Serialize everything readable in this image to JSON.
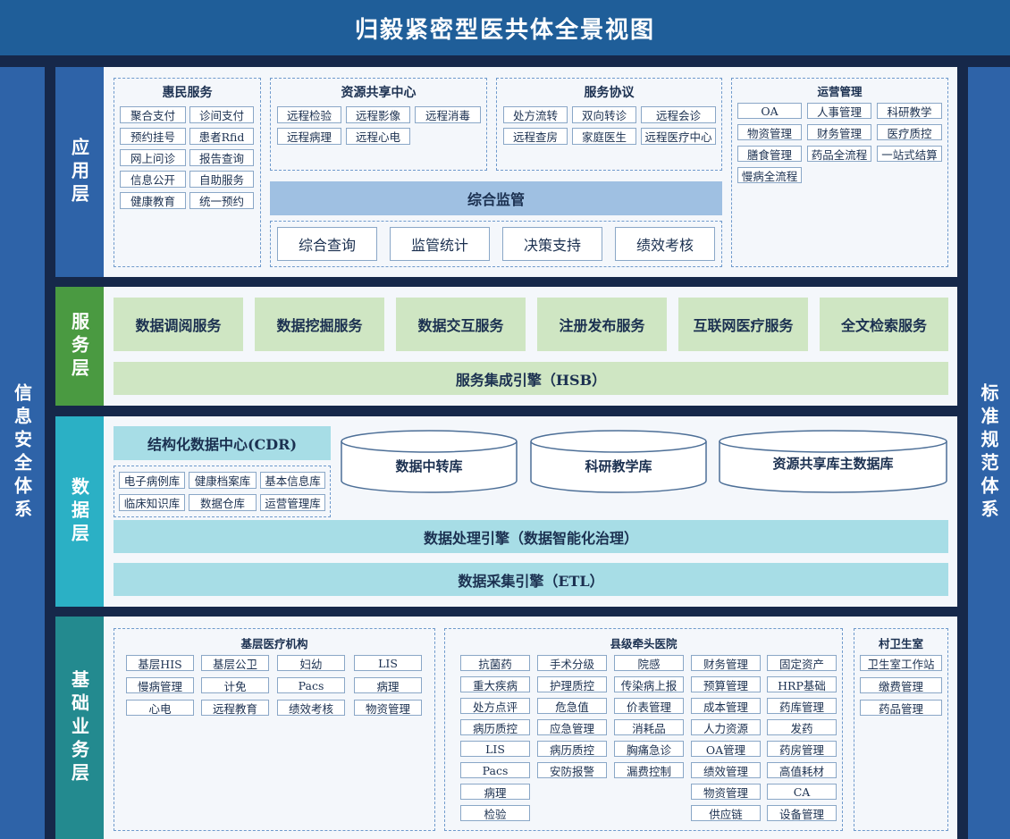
{
  "title": "归毅紧密型医共体全景视图",
  "left_side": "信息安全体系",
  "right_side": "标准规范体系",
  "colors": {
    "title_bg": "#1f5e99",
    "side_bg": "#2e63a8",
    "app_label": "#2e63a8",
    "service_label": "#4a9a41",
    "data_label": "#2bb0c5",
    "base_label": "#238a8f"
  },
  "app_layer": {
    "label": "应用层",
    "huimin": {
      "title": "惠民服务",
      "items": [
        "聚合支付",
        "诊间支付",
        "预约挂号",
        "患者Rfid",
        "网上问诊",
        "报告查询",
        "信息公开",
        "自助服务",
        "健康教育",
        "统一预约"
      ]
    },
    "resource_center": {
      "title": "资源共享中心",
      "items": [
        "远程检验",
        "远程影像",
        "远程消毒",
        "远程病理",
        "远程心电"
      ]
    },
    "service_protocol": {
      "title": "服务协议",
      "items": [
        "处方流转",
        "双向转诊",
        "远程会诊",
        "远程查房",
        "家庭医生",
        "远程医疗中心"
      ]
    },
    "monitor": "综合监管",
    "monitor_items": [
      "综合查询",
      "监管统计",
      "决策支持",
      "绩效考核"
    ],
    "operations": {
      "title": "运营管理",
      "items": [
        "OA",
        "人事管理",
        "科研教学",
        "物资管理",
        "财务管理",
        "医疗质控",
        "膳食管理",
        "药品全流程",
        "一站式结算",
        "慢病全流程"
      ]
    }
  },
  "service_layer": {
    "label": "服务层",
    "items": [
      "数据调阅服务",
      "数据挖掘服务",
      "数据交互服务",
      "注册发布服务",
      "互联网医疗服务",
      "全文检索服务"
    ],
    "engine": "服务集成引擎（HSB）"
  },
  "data_layer": {
    "label": "数据层",
    "cdr_title": "结构化数据中心(CDR)",
    "cdr_items": [
      "电子病例库",
      "健康档案库",
      "基本信息库",
      "临床知识库",
      "数据仓库",
      "运营管理库"
    ],
    "cylinders": [
      "数据中转库",
      "科研教学库",
      "资源共享库主数据库"
    ],
    "engine1": "数据处理引擎（数据智能化治理）",
    "engine2": "数据采集引擎（ETL）"
  },
  "base_layer": {
    "label": "基础业务层",
    "primary": {
      "title": "基层医疗机构",
      "items": [
        "基层HIS",
        "基层公卫",
        "妇幼",
        "LIS",
        "慢病管理",
        "计免",
        "Pacs",
        "病理",
        "心电",
        "远程教育",
        "绩效考核",
        "物资管理"
      ]
    },
    "county": {
      "title": "县级牵头医院",
      "col1": [
        "抗菌药",
        "重大疾病",
        "处方点评",
        "病历质控",
        "LIS",
        "Pacs",
        "病理",
        "检验"
      ],
      "col2": [
        "手术分级",
        "护理质控",
        "危急值",
        "应急管理",
        "病历质控",
        "安防报警"
      ],
      "col3": [
        "院感",
        "传染病上报",
        "价表管理",
        "消耗品",
        "胸痛急诊",
        "漏费控制"
      ],
      "col4": [
        "财务管理",
        "预算管理",
        "成本管理",
        "人力资源",
        "OA管理",
        "绩效管理",
        "物资管理",
        "供应链"
      ],
      "col5": [
        "固定资产",
        "HRP基础",
        "药库管理",
        "发药",
        "药房管理",
        "高值耗材",
        "CA",
        "设备管理"
      ]
    },
    "village": {
      "title": "村卫生室",
      "items": [
        "卫生室工作站",
        "缴费管理",
        "药品管理"
      ]
    }
  }
}
